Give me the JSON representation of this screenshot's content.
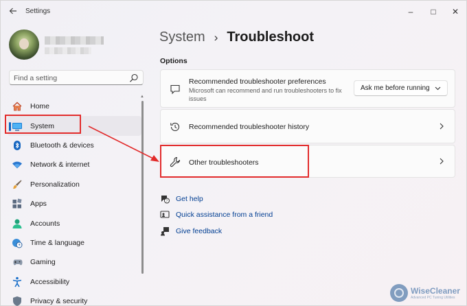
{
  "window": {
    "app_title": "Settings",
    "controls": {
      "minimize": "–",
      "maximize": "□",
      "close": "✕"
    }
  },
  "search": {
    "placeholder": "Find a setting"
  },
  "sidebar": {
    "items": [
      {
        "label": "Home",
        "icon": "home-icon"
      },
      {
        "label": "System",
        "icon": "system-icon",
        "selected": true
      },
      {
        "label": "Bluetooth & devices",
        "icon": "bluetooth-icon"
      },
      {
        "label": "Network & internet",
        "icon": "wifi-icon"
      },
      {
        "label": "Personalization",
        "icon": "brush-icon"
      },
      {
        "label": "Apps",
        "icon": "apps-icon"
      },
      {
        "label": "Accounts",
        "icon": "person-icon"
      },
      {
        "label": "Time & language",
        "icon": "globe-clock-icon"
      },
      {
        "label": "Gaming",
        "icon": "gamepad-icon"
      },
      {
        "label": "Accessibility",
        "icon": "accessibility-icon"
      },
      {
        "label": "Privacy & security",
        "icon": "shield-icon"
      }
    ]
  },
  "main": {
    "breadcrumb": {
      "parent": "System",
      "separator": "›",
      "current": "Troubleshoot"
    },
    "section_title": "Options",
    "cards": [
      {
        "title": "Recommended troubleshooter preferences",
        "description": "Microsoft can recommend and run troubleshooters to fix issues",
        "dropdown_value": "Ask me before running",
        "icon": "message-icon"
      },
      {
        "title": "Recommended troubleshooter history",
        "icon": "history-icon"
      },
      {
        "title": "Other troubleshooters",
        "icon": "wrench-icon"
      }
    ],
    "links": [
      {
        "label": "Get help",
        "icon": "help-icon"
      },
      {
        "label": "Quick assistance from a friend",
        "icon": "quick-assist-icon"
      },
      {
        "label": "Give feedback",
        "icon": "feedback-icon"
      }
    ]
  },
  "colors": {
    "accent": "#0a64c2",
    "annotation": "#e22b2b",
    "link": "#003e92"
  },
  "watermark": {
    "name": "WiseCleaner",
    "tagline": "Advanced PC Tuning Utilities"
  }
}
